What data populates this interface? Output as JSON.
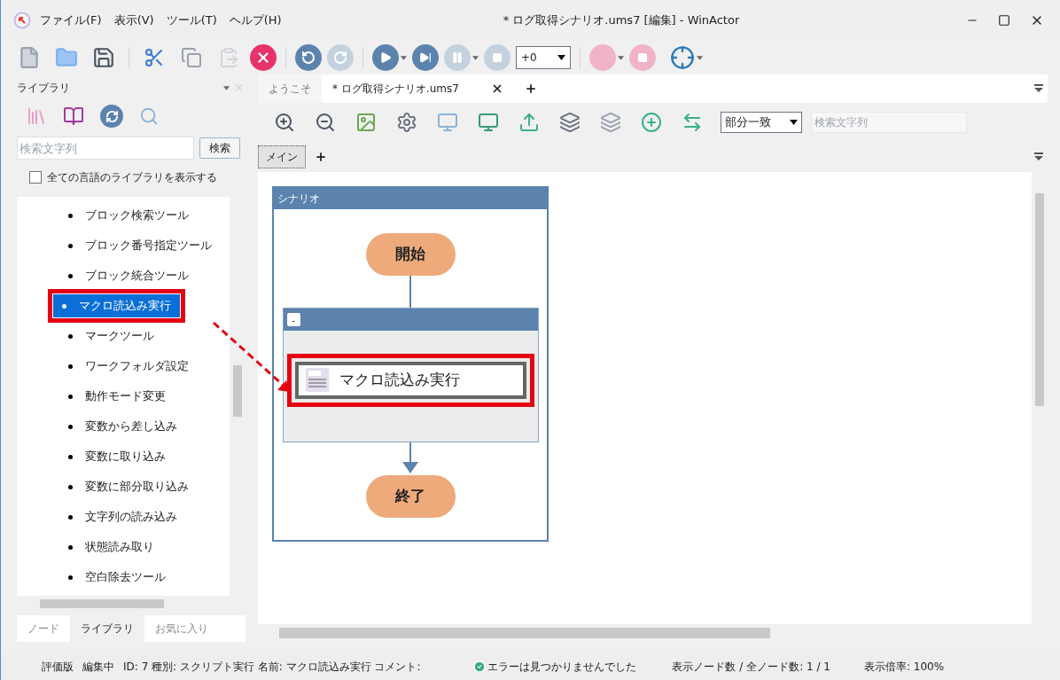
{
  "window": {
    "title": "* ログ取得シナリオ.ums7 [編集] - WinActor",
    "menu": [
      "ファイル(F)",
      "表示(V)",
      "ツール(T)",
      "ヘルプ(H)"
    ]
  },
  "toolbar": {
    "speed_value": "+0"
  },
  "library_panel": {
    "title": "ライブラリ",
    "search_placeholder": "検索文字列",
    "search_button": "検索",
    "show_all_languages": {
      "label": "全ての言語のライブラリを表示する",
      "checked": false
    },
    "items": [
      {
        "label": "ブロック検索ツール",
        "selected": false,
        "highlighted": false
      },
      {
        "label": "ブロック番号指定ツール",
        "selected": false,
        "highlighted": false
      },
      {
        "label": "ブロック統合ツール",
        "selected": false,
        "highlighted": false
      },
      {
        "label": "マクロ読込み実行",
        "selected": true,
        "highlighted": true
      },
      {
        "label": "マークツール",
        "selected": false,
        "highlighted": false
      },
      {
        "label": "ワークフォルダ設定",
        "selected": false,
        "highlighted": false
      },
      {
        "label": "動作モード変更",
        "selected": false,
        "highlighted": false
      },
      {
        "label": "変数から差し込み",
        "selected": false,
        "highlighted": false
      },
      {
        "label": "変数に取り込み",
        "selected": false,
        "highlighted": false
      },
      {
        "label": "変数に部分取り込み",
        "selected": false,
        "highlighted": false
      },
      {
        "label": "文字列の読み込み",
        "selected": false,
        "highlighted": false
      },
      {
        "label": "状態読み取り",
        "selected": false,
        "highlighted": false
      },
      {
        "label": "空白除去ツール",
        "selected": false,
        "highlighted": false
      }
    ],
    "bottom_tabs": [
      {
        "label": "ノード",
        "selected": false
      },
      {
        "label": "ライブラリ",
        "selected": true
      },
      {
        "label": "お気に入り",
        "selected": false
      }
    ]
  },
  "editor": {
    "tabs": [
      {
        "label": "ようこそ",
        "selected": false
      },
      {
        "label": "* ログ取得シナリオ.ums7",
        "selected": true
      }
    ],
    "match_mode": "部分一致",
    "search_placeholder": "検索文字列",
    "sub_tabs": [
      {
        "label": "メイン",
        "selected": true
      }
    ],
    "diagram": {
      "scenario_title": "シナリオ",
      "start": "開始",
      "group_toggle": "-",
      "action": {
        "label": "マクロ読込み実行",
        "highlighted": true
      },
      "end": "終了"
    }
  },
  "status_bar": {
    "edition": "評価版",
    "mode": "編集中",
    "node_info": "ID: 7 種別: スクリプト実行 名前: マクロ読込み実行 コメント:",
    "check_result": "エラーは見つかりませんでした",
    "node_count": "表示ノード数 / 全ノード数: 1 / 1",
    "zoom": "表示倍率: 100%"
  }
}
